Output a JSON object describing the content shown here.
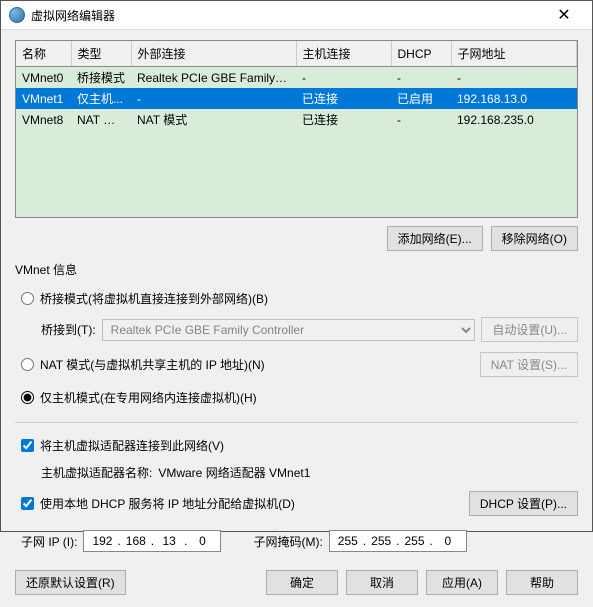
{
  "titlebar": {
    "title": "虚拟网络编辑器"
  },
  "table": {
    "headers": {
      "name": "名称",
      "type": "类型",
      "ext": "外部连接",
      "host": "主机连接",
      "dhcp": "DHCP",
      "subnet": "子网地址"
    },
    "rows": [
      {
        "name": "VMnet0",
        "type": "桥接模式",
        "ext": "Realtek PCIe GBE Family Co...",
        "host": "-",
        "dhcp": "-",
        "subnet": "-"
      },
      {
        "name": "VMnet1",
        "type": "仅主机...",
        "ext": "-",
        "host": "已连接",
        "dhcp": "已启用",
        "subnet": "192.168.13.0"
      },
      {
        "name": "VMnet8",
        "type": "NAT 模式",
        "ext": "NAT 模式",
        "host": "已连接",
        "dhcp": "-",
        "subnet": "192.168.235.0"
      }
    ]
  },
  "buttons": {
    "add": "添加网络(E)...",
    "remove": "移除网络(O)",
    "autoset": "自动设置(U)...",
    "natset": "NAT 设置(S)...",
    "dhcpset": "DHCP 设置(P)...",
    "restore": "还原默认设置(R)",
    "ok": "确定",
    "cancel": "取消",
    "apply": "应用(A)",
    "help": "帮助"
  },
  "info": {
    "groupTitle": "VMnet 信息",
    "bridgedLabel": "桥接模式(将虚拟机直接连接到外部网络)(B)",
    "bridgedTo": "桥接到(T):",
    "bridgedAdapter": "Realtek PCIe GBE Family Controller",
    "natLabel": "NAT 模式(与虚拟机共享主机的 IP 地址)(N)",
    "hostonlyLabel": "仅主机模式(在专用网络内连接虚拟机)(H)",
    "connectHost": "将主机虚拟适配器连接到此网络(V)",
    "hostAdapterLabel": "主机虚拟适配器名称:",
    "hostAdapterName": "VMware 网络适配器 VMnet1",
    "useDhcp": "使用本地 DHCP 服务将 IP 地址分配给虚拟机(D)",
    "subnetIpLabel": "子网 IP (I):",
    "subnetMaskLabel": "子网掩码(M):",
    "ip": {
      "o1": "192",
      "o2": "168",
      "o3": "13",
      "o4": "0"
    },
    "mask": {
      "o1": "255",
      "o2": "255",
      "o3": "255",
      "o4": "0"
    }
  }
}
